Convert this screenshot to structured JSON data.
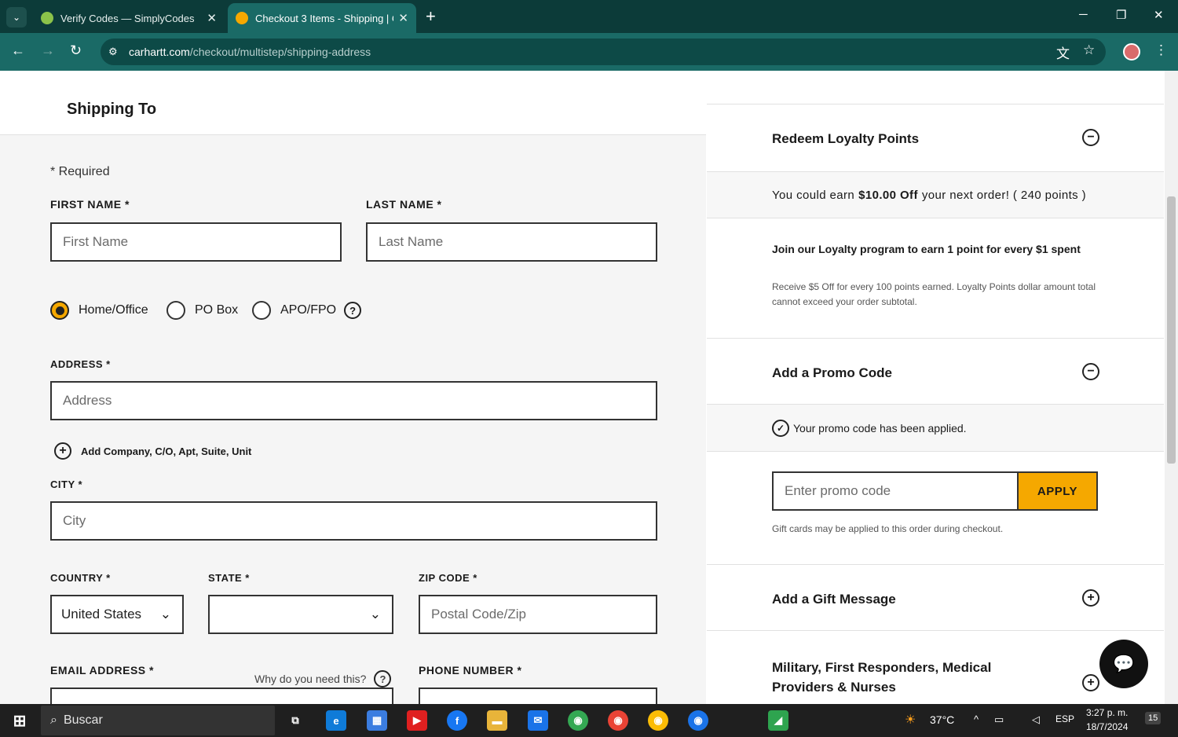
{
  "browser": {
    "tabs": [
      {
        "title": "Verify Codes — SimplyCodes"
      },
      {
        "title": "Checkout 3 Items - Shipping | C"
      }
    ],
    "url_host": "carhartt.com",
    "url_path": "/checkout/multistep/shipping-address"
  },
  "left": {
    "heading": "Shipping To",
    "required_note": "* Required",
    "first_name": {
      "label": "FIRST NAME *",
      "placeholder": "First Name"
    },
    "last_name": {
      "label": "LAST NAME *",
      "placeholder": "Last Name"
    },
    "address_types": [
      {
        "label": "Home/Office",
        "selected": true
      },
      {
        "label": "PO Box",
        "selected": false
      },
      {
        "label": "APO/FPO",
        "selected": false
      }
    ],
    "address": {
      "label": "ADDRESS *",
      "placeholder": "Address"
    },
    "add_company": "Add Company, C/O, Apt, Suite, Unit",
    "city": {
      "label": "CITY *",
      "placeholder": "City"
    },
    "country": {
      "label": "COUNTRY *",
      "value": "United States"
    },
    "state": {
      "label": "STATE *",
      "value": ""
    },
    "zip": {
      "label": "ZIP CODE *",
      "placeholder": "Postal Code/Zip"
    },
    "email": {
      "label": "EMAIL ADDRESS *",
      "why": "Why do you need this?"
    },
    "phone": {
      "label": "PHONE NUMBER *"
    }
  },
  "right": {
    "loyalty": {
      "title": "Redeem Loyalty Points",
      "earn_pre": "You could earn ",
      "earn_bold": "$10.00 Off",
      "earn_post": " your next order! ( 240 points )",
      "join": "Join our Loyalty program to earn 1 point for every $1 spent",
      "info": "Receive $5 Off for every 100 points earned. Loyalty Points dollar amount total cannot exceed your order subtotal."
    },
    "promo": {
      "title": "Add a Promo Code",
      "applied_msg": "Your promo code has been applied.",
      "placeholder": "Enter promo code",
      "apply": "APPLY",
      "gift_note": "Gift cards may be applied to this order during checkout."
    },
    "gift_message": {
      "title": "Add a Gift Message"
    },
    "military": {
      "title": "Military, First Responders, Medical Providers & Nurses"
    }
  },
  "taskbar": {
    "search": "Buscar",
    "weather": "37°C",
    "lang": "ESP",
    "time": "3:27 p. m.",
    "date": "18/7/2024",
    "notif": "15"
  },
  "colors": {
    "accent": "#f5a800",
    "browser": "#1a6a66"
  }
}
